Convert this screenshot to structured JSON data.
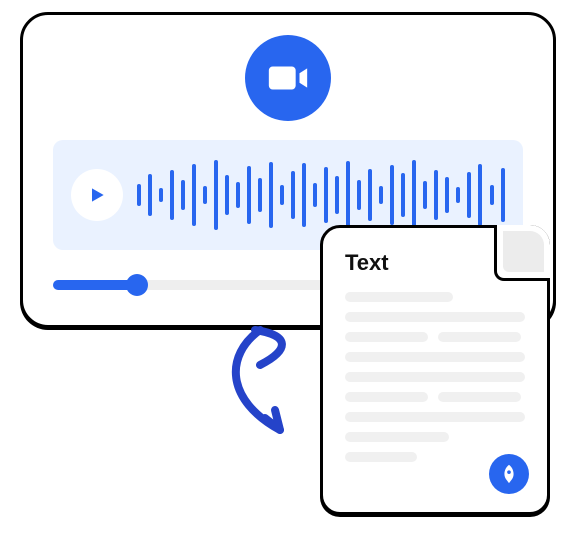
{
  "video_card": {
    "icon": "video-camera",
    "waveform_bars": [
      22,
      42,
      14,
      50,
      30,
      62,
      18,
      70,
      40,
      26,
      58,
      34,
      66,
      20,
      48,
      64,
      24,
      56,
      38,
      68,
      30,
      52,
      18,
      60,
      44,
      70,
      28,
      50,
      36,
      16,
      46,
      62,
      20,
      54
    ],
    "audio_progress_percent": 28
  },
  "document": {
    "title": "Text",
    "badge_icon": "rocket"
  },
  "colors": {
    "primary": "#2866ef",
    "panel_bg": "#eaf2ff"
  }
}
